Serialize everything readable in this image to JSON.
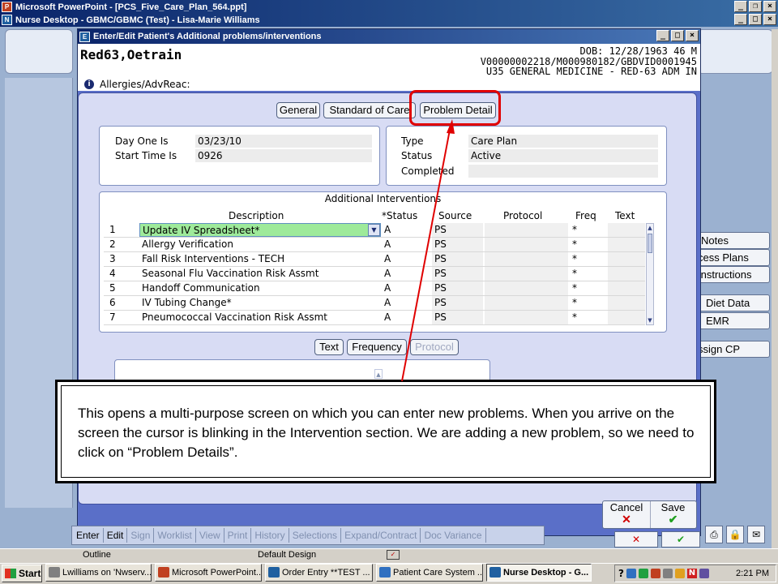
{
  "ppt_window": {
    "title": "Microsoft PowerPoint - [PCS_Five_Care_Plan_564.ppt]"
  },
  "nurse_window": {
    "title": "Nurse Desktop - GBMC/GBMC (Test) - Lisa-Marie Williams"
  },
  "dialog": {
    "title": "Enter/Edit Patient's Additional problems/interventions"
  },
  "patient": {
    "name": "Red63,Oetrain",
    "dob_line": "DOB: 12/28/1963 46 M",
    "id_line": "V00000002218/M000980182/GBDVID0001945",
    "location_line": "U35 GENERAL MEDICINE - RED-63 ADM IN",
    "allergies_label": "Allergies/AdvReac:"
  },
  "tabs": {
    "general": "General",
    "standard_of_care": "Standard of Care",
    "problem_detail": "Problem Detail"
  },
  "dates": {
    "day_one_label": "Day One Is",
    "day_one_value": "03/23/10",
    "start_time_label": "Start Time Is",
    "start_time_value": "0926"
  },
  "plan": {
    "type_label": "Type",
    "type_value": "Care Plan",
    "status_label": "Status",
    "status_value": "Active",
    "completed_label": "Completed",
    "completed_value": ""
  },
  "interventions": {
    "title": "Additional Interventions",
    "columns": {
      "description": "Description",
      "status": "*Status",
      "source": "Source",
      "protocol": "Protocol",
      "freq": "Freq",
      "text": "Text"
    },
    "rows": [
      {
        "num": "1",
        "description": "Update IV Spreadsheet*",
        "status": "A",
        "source": "PS",
        "protocol": "",
        "freq": "*",
        "text": ""
      },
      {
        "num": "2",
        "description": "Allergy Verification",
        "status": "A",
        "source": "PS",
        "protocol": "",
        "freq": "*",
        "text": ""
      },
      {
        "num": "3",
        "description": "Fall Risk Interventions - TECH",
        "status": "A",
        "source": "PS",
        "protocol": "",
        "freq": "*",
        "text": ""
      },
      {
        "num": "4",
        "description": "Seasonal Flu Vaccination Risk Assmt",
        "status": "A",
        "source": "PS",
        "protocol": "",
        "freq": "*",
        "text": ""
      },
      {
        "num": "5",
        "description": "Handoff Communication",
        "status": "A",
        "source": "PS",
        "protocol": "",
        "freq": "*",
        "text": ""
      },
      {
        "num": "6",
        "description": "IV Tubing Change*",
        "status": "A",
        "source": "PS",
        "protocol": "",
        "freq": "*",
        "text": ""
      },
      {
        "num": "7",
        "description": "Pneumococcal Vaccination Risk Assmt",
        "status": "A",
        "source": "PS",
        "protocol": "",
        "freq": "*",
        "text": ""
      }
    ]
  },
  "subtabs": {
    "text": "Text",
    "frequency": "Frequency",
    "protocol": "Protocol"
  },
  "side_buttons": {
    "notes": "Notes",
    "process_plans": "cess Plans",
    "instructions": "Instructions",
    "diet_data": "Diet Data",
    "emr": "EMR",
    "assign_cp": "ssign CP"
  },
  "actions": {
    "cancel": "Cancel",
    "save": "Save"
  },
  "bottom_menu": [
    "Enter",
    "Edit",
    "Sign",
    "Worklist",
    "View",
    "Print",
    "History",
    "Selections",
    "Expand/Contract",
    "Doc Variance"
  ],
  "ppt_status": {
    "outline": "Outline",
    "design": "Default Design"
  },
  "annotation": {
    "text": "This opens a multi-purpose screen on which you can enter new problems. When you arrive on the screen the cursor is blinking in the Intervention section. We are adding a new problem, so we need to click on “Problem Details”."
  },
  "taskbar": {
    "start": "Start",
    "items": [
      "Lwilliams on 'Nwserv...",
      "Microsoft PowerPoint...",
      "Order Entry **TEST ...",
      "Patient Care System ...",
      "Nurse Desktop - G..."
    ],
    "clock": "2:21 PM"
  },
  "colors": {
    "titlebar": "#0a246a",
    "dialog_bg": "#5a6fc8",
    "panel_bg": "#d8dcf4",
    "highlight": "#9eea9a",
    "callout_red": "#e00000"
  }
}
